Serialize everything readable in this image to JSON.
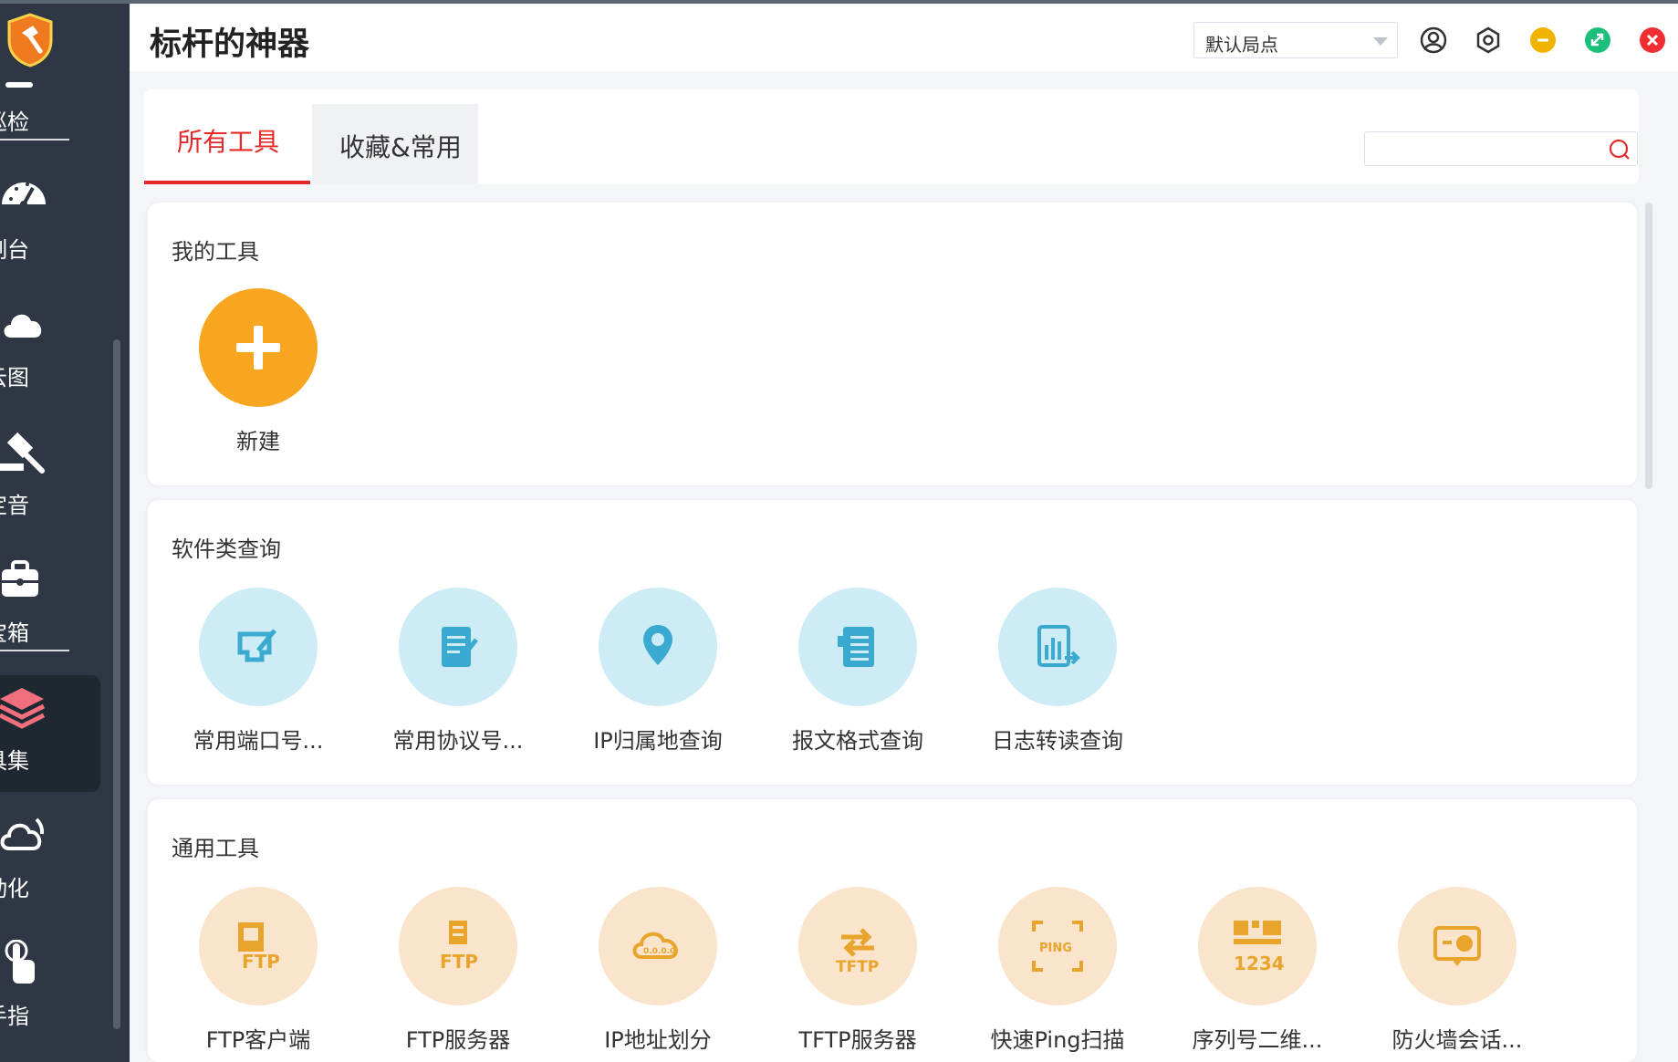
{
  "app": {
    "title": "标杆的神器"
  },
  "header": {
    "site_select": "默认局点",
    "icons": [
      "user-icon",
      "settings-icon",
      "minimize-icon",
      "maximize-icon",
      "close-icon"
    ]
  },
  "sidebar": {
    "items": [
      {
        "label": "的巡检",
        "icon": "inspection-icon"
      },
      {
        "label": "控制台",
        "icon": "dashboard-icon"
      },
      {
        "label": "权云图",
        "icon": "cloud-icon"
      },
      {
        "label": "锤定音",
        "icon": "gavel-icon"
      },
      {
        "label": "具宝箱",
        "icon": "toolbox-icon"
      },
      {
        "label": "工具集",
        "icon": "layers-icon",
        "active": true
      },
      {
        "label": "自动化",
        "icon": "automation-icon"
      },
      {
        "label": "金手指",
        "icon": "pointer-hand-icon"
      }
    ]
  },
  "tabs": [
    {
      "label": "所有工具",
      "active": true
    },
    {
      "label": "收藏&常用",
      "active": false
    }
  ],
  "search": {
    "placeholder": "",
    "value": ""
  },
  "sections": {
    "mine": {
      "title": "我的工具",
      "tools": [
        {
          "label": "新建",
          "icon": "plus-icon"
        }
      ]
    },
    "software": {
      "title": "软件类查询",
      "tools": [
        {
          "label": "常用端口号...",
          "icon": "port-icon"
        },
        {
          "label": "常用协议号...",
          "icon": "protocol-doc-icon"
        },
        {
          "label": "IP归属地查询",
          "icon": "location-pin-icon"
        },
        {
          "label": "报文格式查询",
          "icon": "packet-doc-icon"
        },
        {
          "label": "日志转读查询",
          "icon": "log-chart-icon"
        }
      ]
    },
    "general": {
      "title": "通用工具",
      "tools": [
        {
          "label": "FTP客户端",
          "icon": "ftp-client-icon"
        },
        {
          "label": "FTP服务器",
          "icon": "ftp-server-icon"
        },
        {
          "label": "IP地址划分",
          "icon": "subnet-cloud-icon"
        },
        {
          "label": "TFTP服务器",
          "icon": "tftp-icon"
        },
        {
          "label": "快速Ping扫描",
          "icon": "ping-scan-icon"
        },
        {
          "label": "序列号二维...",
          "icon": "serial-qr-icon"
        },
        {
          "label": "防火墙会话...",
          "icon": "firewall-session-icon"
        }
      ]
    }
  },
  "colors": {
    "sidebar_bg": "#2e3743",
    "accent_red": "#e32b2b",
    "new_orange": "#f8a51f",
    "blue_icon_bg": "#cdecf6",
    "blue_icon": "#3aaad0",
    "orange_icon_bg": "#fae4cb",
    "orange_icon": "#e9a42c"
  }
}
